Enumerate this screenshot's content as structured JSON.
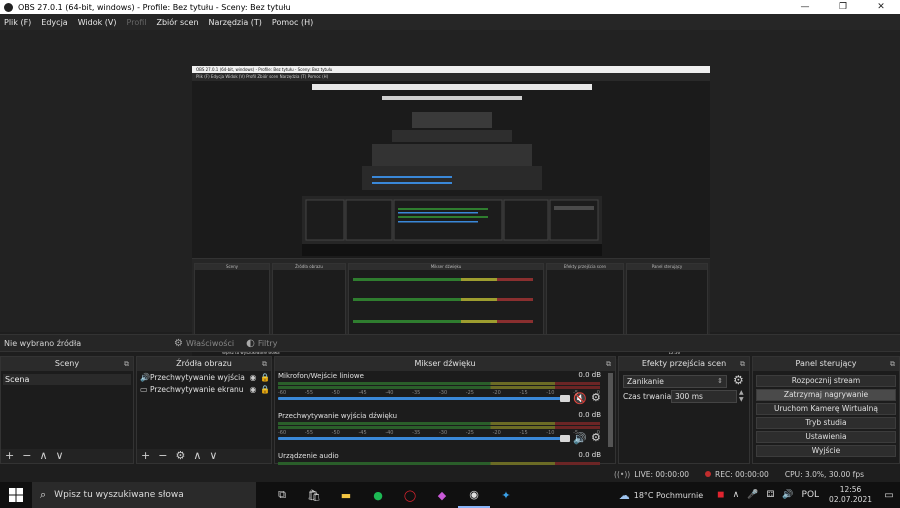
{
  "window": {
    "title": "OBS 27.0.1 (64-bit, windows) - Profile: Bez tytułu - Sceny: Bez tytułu",
    "minimize": "—",
    "maximize": "❐",
    "close": "✕"
  },
  "menu": {
    "items": [
      "Plik (F)",
      "Edycja",
      "Widok (V)",
      "Profil",
      "Zbiór scen",
      "Narzędzia (T)",
      "Pomoc (H)"
    ]
  },
  "nested": {
    "title": "OBS 27.0.1 (64-bit, windows) - Profile: Bez tytułu - Sceny: Bez tytułu",
    "menu": "Plik (F)   Edycja   Widok (V)   Profil   Zbiór scen   Narzędzia (T)   Pomoc (H)",
    "search": "Wpisz tu wyszukiwane słowa",
    "docks": [
      "Sceny",
      "Źródła obrazu",
      "Mikser dźwięku",
      "Efekty przejścia scen",
      "Panel sterujący"
    ],
    "status_text": "Nie wybrano źródła",
    "time": "12:56",
    "date": "02.07.2021"
  },
  "source_status": {
    "text": "Nie wybrano źródła",
    "properties": "Właściwości",
    "filters": "Filtry"
  },
  "scenes": {
    "header": "Sceny",
    "items": [
      "Scena"
    ]
  },
  "sources": {
    "header": "Źródła obrazu",
    "items": [
      {
        "label": "Przechwytywanie wyjścia c",
        "icon": "speaker-icon"
      },
      {
        "label": "Przechwytywanie ekranu",
        "icon": "monitor-icon"
      }
    ]
  },
  "mixer": {
    "header": "Mikser dźwięku",
    "ticks": [
      "-60",
      "-55",
      "-50",
      "-45",
      "-40",
      "-35",
      "-30",
      "-25",
      "-20",
      "-15",
      "-10",
      "-5",
      "0"
    ],
    "channels": [
      {
        "name": "Mikrofon/Wejście liniowe",
        "db": "0.0 dB",
        "muted": true,
        "level": 0.9
      },
      {
        "name": "Przechwytywanie wyjścia dźwięku",
        "db": "0.0 dB",
        "muted": false,
        "level": 0.9
      },
      {
        "name": "Urządzenie audio",
        "db": "0.0 dB",
        "muted": false,
        "level": 0.9
      }
    ]
  },
  "transitions": {
    "header": "Efekty przejścia scen",
    "selected": "Zanikanie",
    "duration_label": "Czas trwania",
    "duration_value": "300 ms"
  },
  "controls": {
    "header": "Panel sterujący",
    "buttons": [
      "Rozpocznij stream",
      "Zatrzymaj nagrywanie",
      "Uruchom Kamerę Wirtualną",
      "Tryb studia",
      "Ustawienia",
      "Wyjście"
    ],
    "active_index": 1
  },
  "status": {
    "live": "LIVE: 00:00:00",
    "rec": "REC: 00:00:00",
    "cpu": "CPU: 3.0%, 30.00 fps"
  },
  "taskbar": {
    "search_placeholder": "Wpisz tu wyszukiwane słowa",
    "weather": "18°C  Pochmurnie",
    "language": "POL",
    "time": "12:56",
    "date": "02.07.2021"
  },
  "colors": {
    "accent": "#3a88d8",
    "rec": "#c12d2d",
    "mute": "#e23030"
  }
}
